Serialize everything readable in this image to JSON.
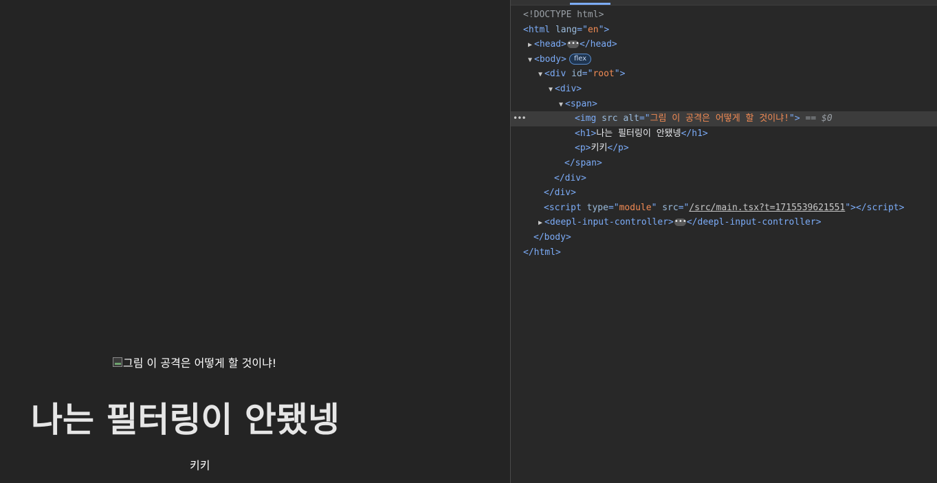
{
  "preview": {
    "img_alt": "그림 이 공격은 어떻게 할 것이냐!",
    "heading": "나는 필터링이 안됐넹",
    "paragraph": "키키"
  },
  "devtools": {
    "doctype": "<!DOCTYPE html>",
    "html_lang": "en",
    "body_badge": "flex",
    "root_id": "root",
    "img_alt": "그림 이 공격은 어떻게 할 것이냐!",
    "selected_marker": "== $0",
    "h1_text": "나는 필터링이 안됐넹",
    "p_text": "키키",
    "script_type": "module",
    "script_src": "/src/main.tsx?t=1715539621551",
    "custom_element": "deepl-input-controller"
  }
}
